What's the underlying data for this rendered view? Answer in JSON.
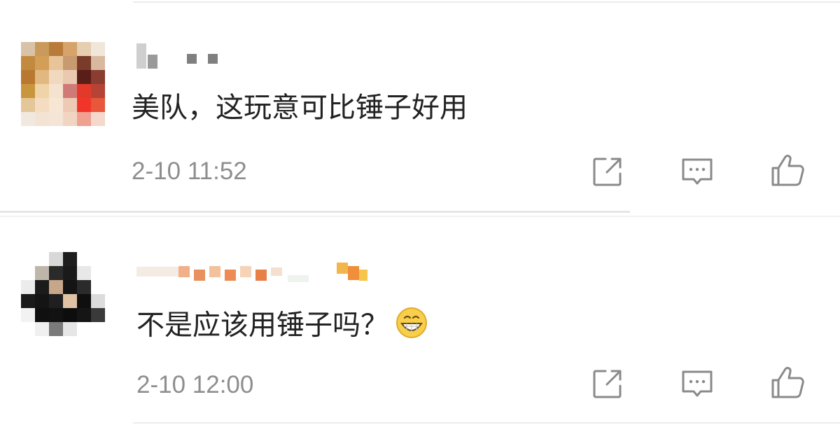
{
  "comments": [
    {
      "username": "",
      "text": "美队，这玩意可比锤子好用",
      "time": "2-10 11:52"
    },
    {
      "username": "",
      "text": "不是应该用锤子吗？",
      "emoji": "grin-emoji",
      "time": "2-10 12:00"
    }
  ],
  "icons": {
    "share": "share-icon",
    "reply": "comment-icon",
    "like": "thumbs-up-icon"
  },
  "colors": {
    "text": "#222222",
    "time": "#8e8e8e",
    "icon": "#8a8a8a",
    "divider": "#e6e6e6"
  }
}
